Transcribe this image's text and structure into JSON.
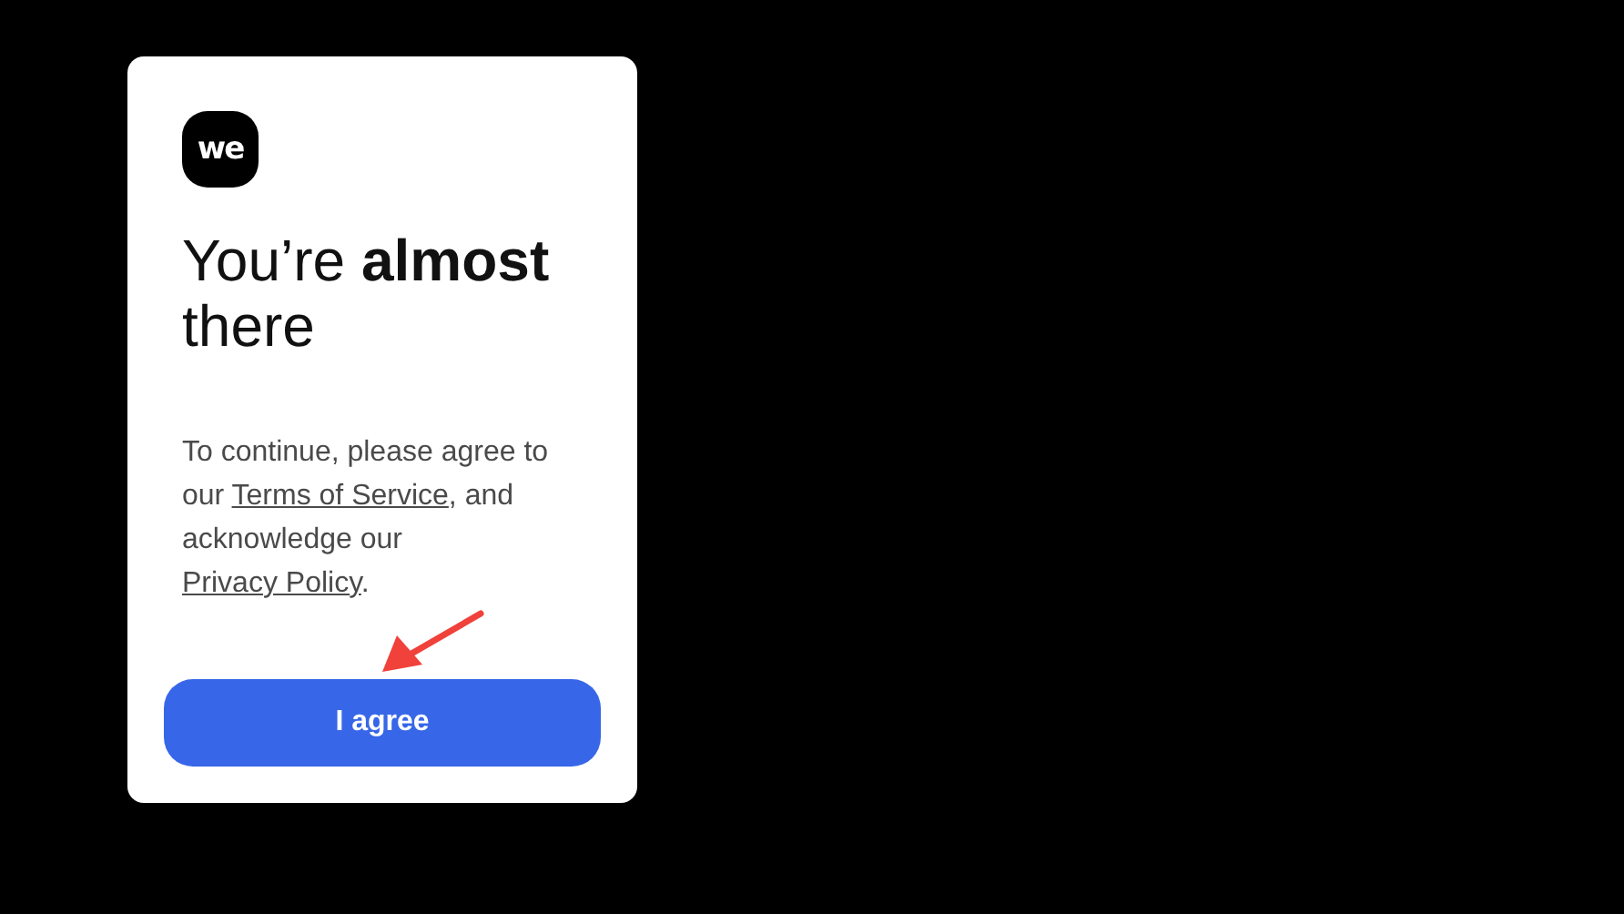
{
  "dialog": {
    "logo": "we",
    "heading": "You’re **almost** there",
    "message": [
      {
        "kind": "text",
        "text": "To continue, please agree to our "
      },
      {
        "kind": "link",
        "text": "Terms of Service"
      },
      {
        "kind": "text",
        "text": ", and acknowledge our "
      },
      {
        "kind": "link",
        "text": "Privacy Policy"
      },
      {
        "kind": "text",
        "text": "."
      }
    ],
    "button": "I agree"
  }
}
